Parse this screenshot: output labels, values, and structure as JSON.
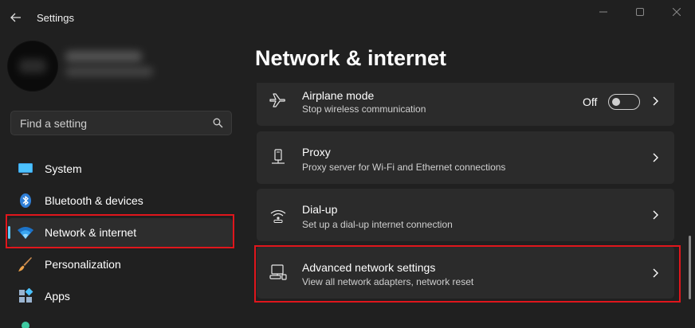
{
  "window": {
    "title": "Settings"
  },
  "search": {
    "placeholder": "Find a setting"
  },
  "sidebar": {
    "items": [
      {
        "label": "System",
        "icon": "monitor-icon"
      },
      {
        "label": "Bluetooth & devices",
        "icon": "bluetooth-icon"
      },
      {
        "label": "Network & internet",
        "icon": "wifi-icon",
        "active": true
      },
      {
        "label": "Personalization",
        "icon": "brush-icon"
      },
      {
        "label": "Apps",
        "icon": "apps-icon"
      }
    ]
  },
  "page": {
    "title": "Network & internet"
  },
  "settings": [
    {
      "title": "Airplane mode",
      "subtitle": "Stop wireless communication",
      "toggle_label": "Off",
      "toggle_on": false,
      "icon": "airplane-icon"
    },
    {
      "title": "Proxy",
      "subtitle": "Proxy server for Wi-Fi and Ethernet connections",
      "icon": "proxy-icon"
    },
    {
      "title": "Dial-up",
      "subtitle": "Set up a dial-up internet connection",
      "icon": "dialup-icon"
    },
    {
      "title": "Advanced network settings",
      "subtitle": "View all network adapters, network reset",
      "icon": "network-adapter-icon"
    }
  ],
  "colors": {
    "accent": "#60cdff",
    "highlight": "#e0161c",
    "background": "#202020",
    "card": "#2b2b2b"
  }
}
